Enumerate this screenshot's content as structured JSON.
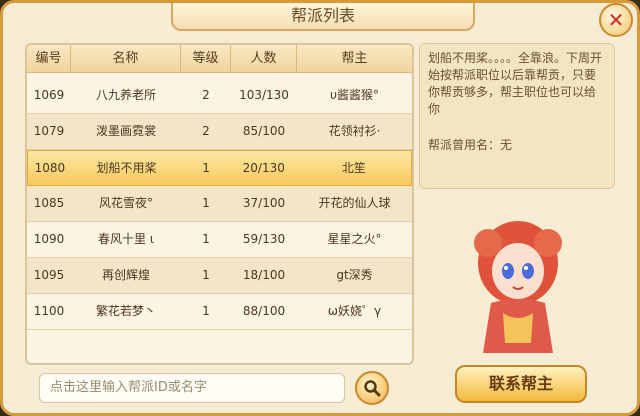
{
  "window": {
    "title": "帮派列表"
  },
  "table": {
    "headers": [
      "编号",
      "名称",
      "等级",
      "人数",
      "帮主"
    ],
    "rows": [
      {
        "id": "1069",
        "name": "八九养老所",
        "level": "2",
        "members": "103/130",
        "leader": "υ酱酱猴°"
      },
      {
        "id": "1079",
        "name": "泼墨画霓裳",
        "level": "2",
        "members": "85/100",
        "leader": "花领衬衫·"
      },
      {
        "id": "1080",
        "name": "划船不用桨",
        "level": "1",
        "members": "20/130",
        "leader": "北笙"
      },
      {
        "id": "1085",
        "name": "风花雪夜°",
        "level": "1",
        "members": "37/100",
        "leader": "开花的仙人球"
      },
      {
        "id": "1090",
        "name": "春风十里 ι",
        "level": "1",
        "members": "59/130",
        "leader": "星星之火°"
      },
      {
        "id": "1095",
        "name": "再创辉煌",
        "level": "1",
        "members": "18/100",
        "leader": "gt深秀"
      },
      {
        "id": "1100",
        "name": "繁花若梦丶",
        "level": "1",
        "members": "88/100",
        "leader": "ω妖娆゜γ"
      }
    ],
    "selected_index": 2
  },
  "info": {
    "description": "划船不用桨。。。。全靠浪。下周开始按帮派职位以后靠帮贡，只要你帮贡够多，帮主职位也可以给你",
    "former_name": "帮派曾用名：无"
  },
  "search": {
    "placeholder": "点击这里输入帮派ID或名字"
  },
  "buttons": {
    "contact_leader": "联系帮主"
  },
  "icons": {
    "close": "close-icon",
    "search": "search-icon",
    "character": "character-portrait"
  },
  "colors": {
    "accent": "#f7c95c",
    "close": "#d12a1e"
  }
}
